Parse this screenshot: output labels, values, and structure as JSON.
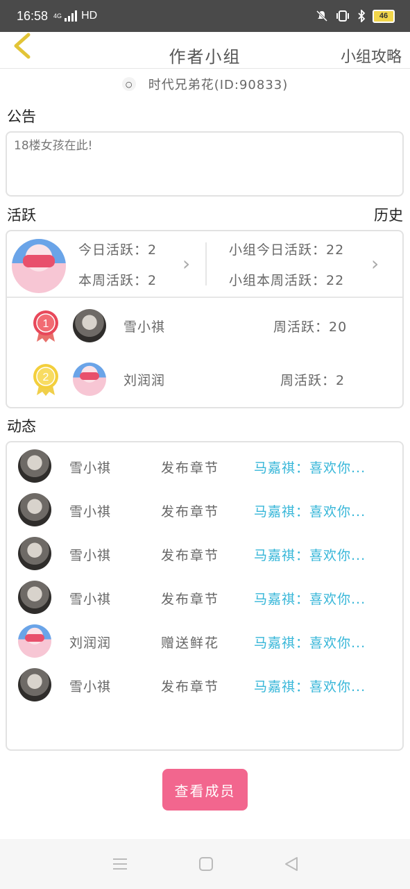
{
  "status_bar": {
    "time": "16:58",
    "network": "4G",
    "signal_label": "HD",
    "battery": "46"
  },
  "nav": {
    "title": "作者小组",
    "right_link": "小组攻略"
  },
  "owner": {
    "text": "时代兄弟花(ID:90833)"
  },
  "notice": {
    "label": "公告",
    "text": "18楼女孩在此!"
  },
  "activity": {
    "label": "活跃",
    "history": "历史",
    "my_today": "今日活跃：2",
    "my_week": "本周活跃：2",
    "group_today": "小组今日活跃：22",
    "group_week": "小组本周活跃：22",
    "ranks": [
      {
        "rank": "1",
        "name": "雪小祺",
        "week": "周活跃：20"
      },
      {
        "rank": "2",
        "name": "刘润润",
        "week": "周活跃：2"
      }
    ]
  },
  "feed": {
    "label": "动态",
    "items": [
      {
        "name": "雪小祺",
        "action": "发布章节",
        "detail": "马嘉祺：喜欢你..."
      },
      {
        "name": "雪小祺",
        "action": "发布章节",
        "detail": "马嘉祺：喜欢你..."
      },
      {
        "name": "雪小祺",
        "action": "发布章节",
        "detail": "马嘉祺：喜欢你..."
      },
      {
        "name": "雪小祺",
        "action": "发布章节",
        "detail": "马嘉祺：喜欢你..."
      },
      {
        "name": "刘润润",
        "action": "赠送鲜花",
        "detail": "马嘉祺：喜欢你..."
      },
      {
        "name": "雪小祺",
        "action": "发布章节",
        "detail": "马嘉祺：喜欢你..."
      }
    ]
  },
  "members_button": "查看成员",
  "colors": {
    "accent_pink": "#f2668e",
    "link_blue": "#36b6d8",
    "back_arrow": "#e2c437"
  }
}
